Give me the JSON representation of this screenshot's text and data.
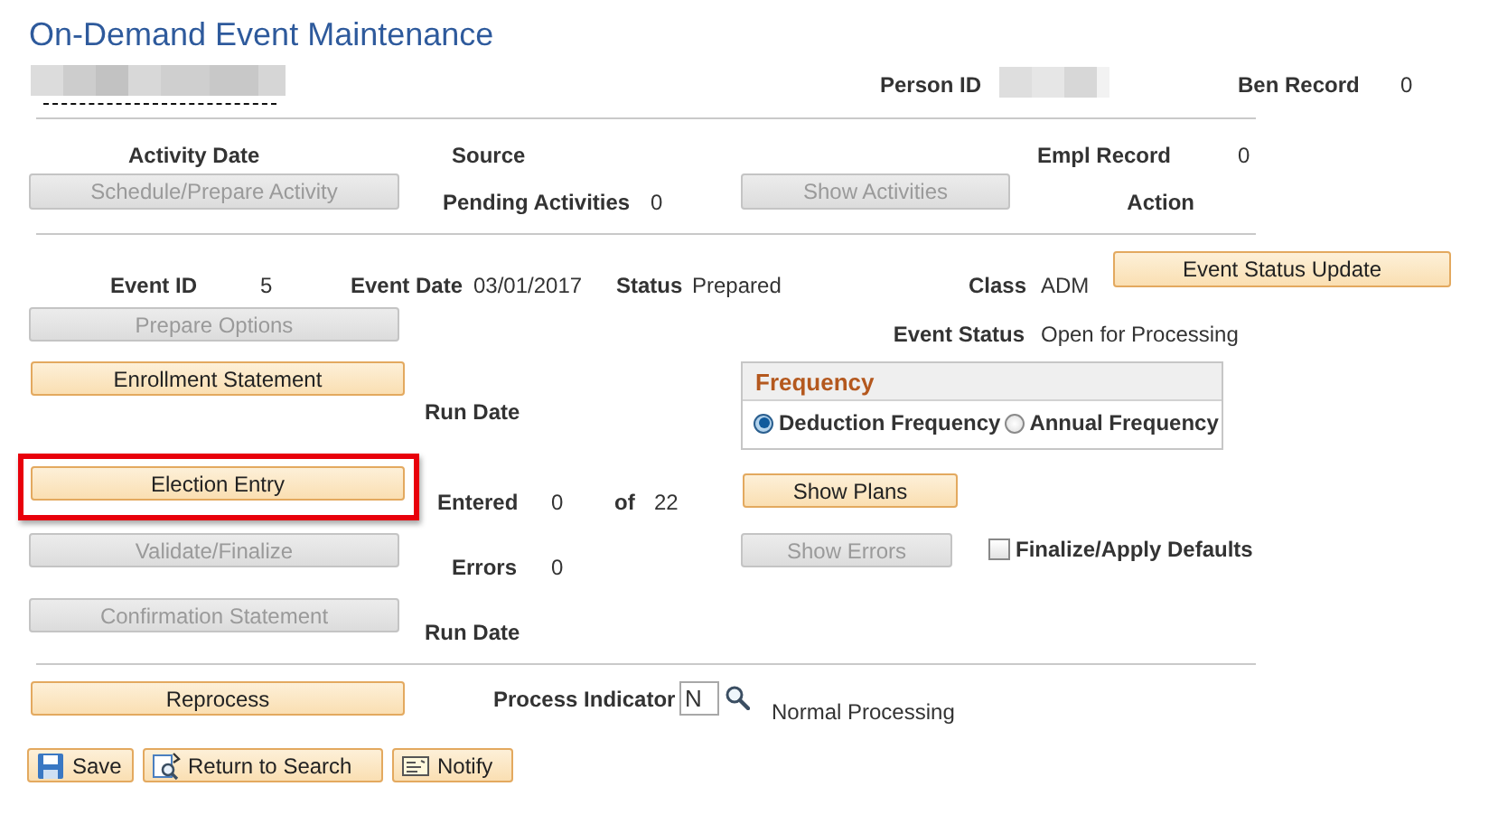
{
  "title": "On-Demand Event Maintenance",
  "header": {
    "person_id_label": "Person ID",
    "ben_record_label": "Ben Record",
    "ben_record": "0"
  },
  "activity": {
    "activity_date_label": "Activity Date",
    "source_label": "Source",
    "empl_record_label": "Empl Record",
    "empl_record": "0",
    "schedule_button": {
      "label": "Schedule/Prepare Activity",
      "disabled": true
    },
    "pending_label": "Pending Activities",
    "pending": "0",
    "show_activities_button": {
      "label": "Show Activities",
      "disabled": true
    },
    "action_label": "Action"
  },
  "event": {
    "status_update_button": {
      "label": "Event Status Update",
      "disabled": false
    },
    "event_id_label": "Event ID",
    "event_id": "5",
    "event_date_label": "Event Date",
    "event_date": "03/01/2017",
    "status_label": "Status",
    "status": "Prepared",
    "class_label": "Class",
    "class": "ADM",
    "prepare_options_button": {
      "label": "Prepare Options",
      "disabled": true
    },
    "event_status_label": "Event Status",
    "event_status": "Open for Processing",
    "enrollment_button": {
      "label": "Enrollment Statement",
      "disabled": false
    },
    "enrollment_run_date_label": "Run Date",
    "frequency": {
      "title": "Frequency",
      "options": [
        {
          "label": "Deduction Frequency",
          "selected": true
        },
        {
          "label": "Annual Frequency",
          "selected": false
        }
      ]
    },
    "election_button": {
      "label": "Election Entry",
      "disabled": false,
      "highlighted": true
    },
    "entered_label": "Entered",
    "entered": "0",
    "of_label": "of",
    "total": "22",
    "show_plans_button": {
      "label": "Show Plans",
      "disabled": false
    },
    "validate_button": {
      "label": "Validate/Finalize",
      "disabled": true
    },
    "errors_label": "Errors",
    "errors": "0",
    "show_errors_button": {
      "label": "Show Errors",
      "disabled": true
    },
    "finalize_checkbox": {
      "label": "Finalize/Apply Defaults",
      "checked": false
    },
    "confirmation_button": {
      "label": "Confirmation Statement",
      "disabled": true
    },
    "confirmation_run_date_label": "Run Date",
    "reprocess_button": {
      "label": "Reprocess",
      "disabled": false
    },
    "process_indicator_label": "Process Indicator",
    "process_indicator": "N",
    "process_description": "Normal Processing"
  },
  "toolbar": [
    {
      "kind": "save",
      "label": "Save"
    },
    {
      "kind": "return",
      "label": "Return to Search"
    },
    {
      "kind": "notify",
      "label": "Notify"
    }
  ]
}
